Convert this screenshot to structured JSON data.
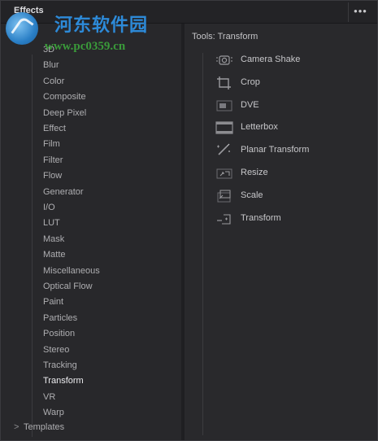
{
  "panel": {
    "title": "Effects",
    "menu_label": "•••"
  },
  "watermark": {
    "chinese_text": "河东软件园",
    "url_text": "www.pc0359.cn"
  },
  "categories": [
    "3D",
    "Blur",
    "Color",
    "Composite",
    "Deep Pixel",
    "Effect",
    "Film",
    "Filter",
    "Flow",
    "Generator",
    "I/O",
    "LUT",
    "Mask",
    "Matte",
    "Miscellaneous",
    "Optical Flow",
    "Paint",
    "Particles",
    "Position",
    "Stereo",
    "Tracking",
    "Transform",
    "VR",
    "Warp"
  ],
  "selected_category": "Transform",
  "templates": {
    "label": "Templates",
    "icon": "chevron-right-icon"
  },
  "tools_header": "Tools: Transform",
  "tools": [
    {
      "label": "Camera Shake",
      "icon": "camera-shake-icon"
    },
    {
      "label": "Crop",
      "icon": "crop-icon"
    },
    {
      "label": "DVE",
      "icon": "dve-icon"
    },
    {
      "label": "Letterbox",
      "icon": "letterbox-icon"
    },
    {
      "label": "Planar Transform",
      "icon": "planar-transform-icon"
    },
    {
      "label": "Resize",
      "icon": "resize-icon"
    },
    {
      "label": "Scale",
      "icon": "scale-icon"
    },
    {
      "label": "Transform",
      "icon": "transform-icon"
    }
  ]
}
